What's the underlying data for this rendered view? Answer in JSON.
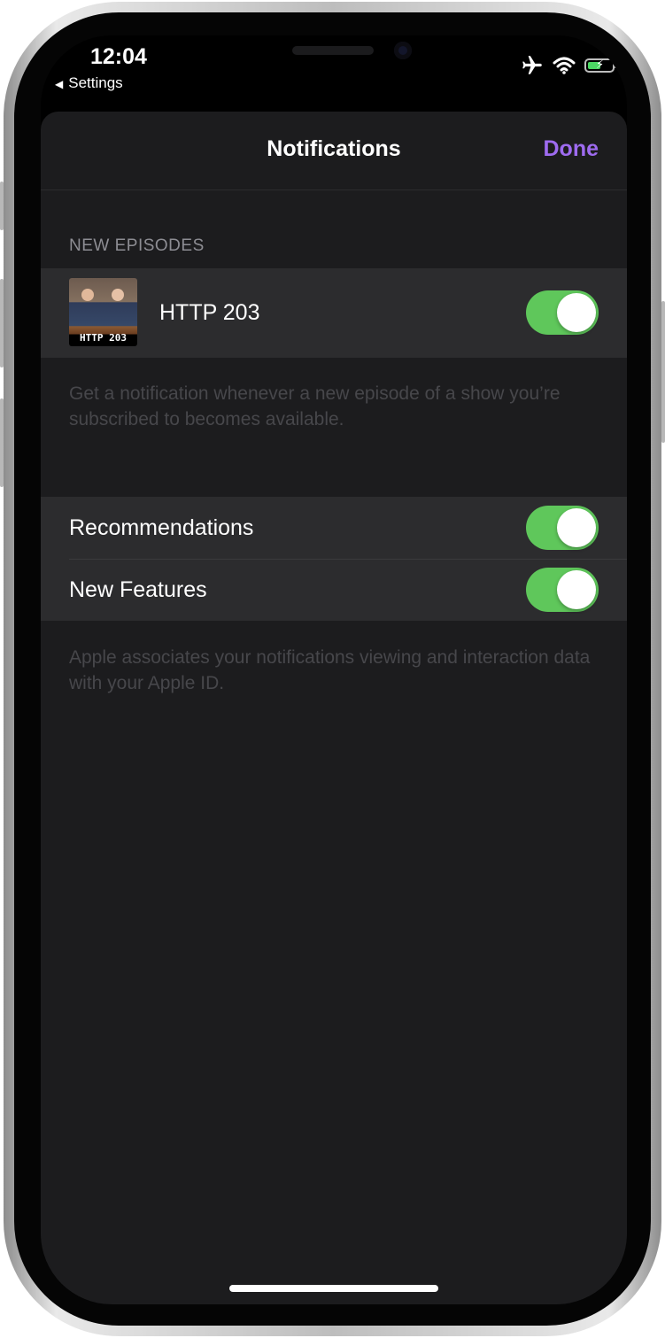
{
  "status_bar": {
    "time": "12:04",
    "back_label": "Settings",
    "icons": [
      "airplane-icon",
      "wifi-icon",
      "battery-charging-icon"
    ],
    "battery_level": 0.6
  },
  "nav": {
    "title": "Notifications",
    "done_label": "Done",
    "accent_color": "#9e6bf0"
  },
  "new_episodes": {
    "header": "NEW EPISODES",
    "podcast": {
      "title": "HTTP 203",
      "artwork_text": "HTTP 203",
      "enabled": true
    },
    "footer": "Get a notification whenever a new episode of a show you’re subscribed to becomes available."
  },
  "other": {
    "rows": [
      {
        "label": "Recommendations",
        "enabled": true
      },
      {
        "label": "New Features",
        "enabled": true
      }
    ],
    "footer": "Apple associates your notifications viewing and interaction data with your Apple ID."
  },
  "colors": {
    "toggle_on": "#5fc75b",
    "background": "#1c1c1e",
    "cell": "#2c2c2e"
  }
}
